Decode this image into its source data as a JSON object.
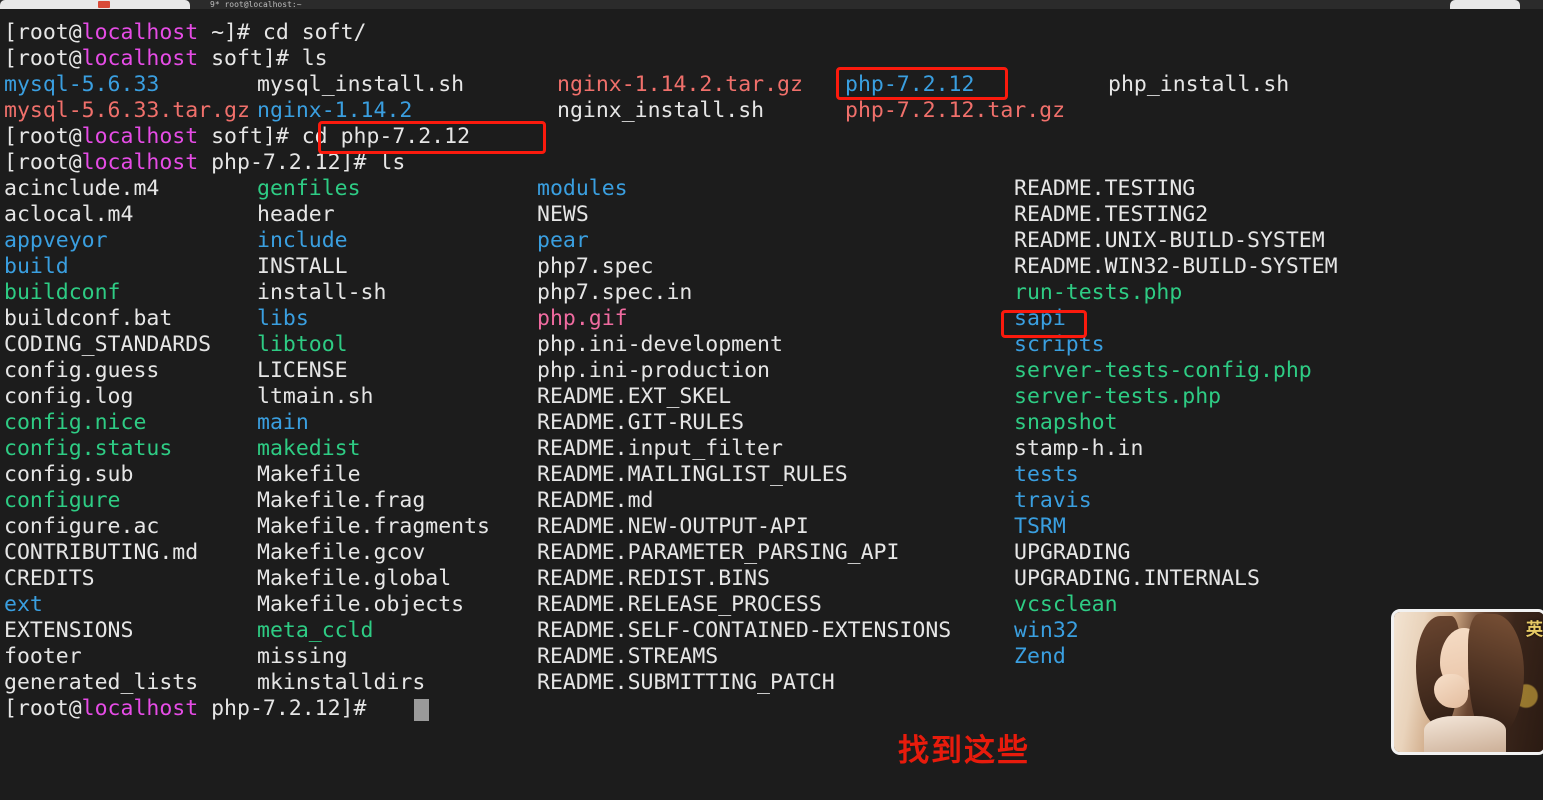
{
  "window": {
    "tab_label": "9* root@localhost:~",
    "background_color": "#1c1c1c"
  },
  "colors": {
    "white": "#e6e6e6",
    "magenta": "#e64ce6",
    "directory_blue": "#3a9fe0",
    "executable_green": "#2ecc84",
    "archive_red": "#f0706b",
    "image_pink": "#f06ba0",
    "highlight_red": "#fb1a0d",
    "annotation_red": "#e81b0c"
  },
  "terminal": {
    "prompt_segments_root": "[root@",
    "prompt_host": "localhost",
    "lines": [
      {
        "type": "prompt",
        "prefix": "[root@",
        "host": "localhost",
        "suffix": " ~]# ",
        "command": "cd soft/"
      },
      {
        "type": "prompt",
        "prefix": "[root@",
        "host": "localhost",
        "suffix": " soft]# ",
        "command": "ls"
      }
    ],
    "soft_listing": [
      [
        {
          "text": "mysql-5.6.33",
          "color": "c-dirblue"
        },
        {
          "text": "mysql_install.sh",
          "color": "c-white"
        },
        {
          "text": "nginx-1.14.2.tar.gz",
          "color": "c-red"
        },
        {
          "text": "php-7.2.12",
          "color": "c-dirblue"
        },
        {
          "text": "php_install.sh",
          "color": "c-white"
        }
      ],
      [
        {
          "text": "mysql-5.6.33.tar.gz",
          "color": "c-red"
        },
        {
          "text": "nginx-1.14.2",
          "color": "c-dirblue"
        },
        {
          "text": "nginx_install.sh",
          "color": "c-white"
        },
        {
          "text": "php-7.2.12.tar.gz",
          "color": "c-red"
        },
        {
          "text": "",
          "color": "c-white"
        }
      ]
    ],
    "cd_prompt": {
      "prefix": "[root@",
      "host": "localhost",
      "suffix": " soft]# ",
      "command": "cd php-7.2.12"
    },
    "ls_prompt": {
      "prefix": "[root@",
      "host": "localhost",
      "suffix": " php-7.2.12]# ",
      "command": "ls"
    },
    "final_prompt": {
      "prefix": "[root@",
      "host": "localhost",
      "suffix": " php-7.2.12]# ",
      "command": ""
    },
    "php_listing": {
      "column1": [
        {
          "text": "acinclude.m4",
          "color": "c-white"
        },
        {
          "text": "aclocal.m4",
          "color": "c-white"
        },
        {
          "text": "appveyor",
          "color": "c-dirblue"
        },
        {
          "text": "build",
          "color": "c-dirblue"
        },
        {
          "text": "buildconf",
          "color": "c-green"
        },
        {
          "text": "buildconf.bat",
          "color": "c-white"
        },
        {
          "text": "CODING_STANDARDS",
          "color": "c-white"
        },
        {
          "text": "config.guess",
          "color": "c-white"
        },
        {
          "text": "config.log",
          "color": "c-white"
        },
        {
          "text": "config.nice",
          "color": "c-green"
        },
        {
          "text": "config.status",
          "color": "c-green"
        },
        {
          "text": "config.sub",
          "color": "c-white"
        },
        {
          "text": "configure",
          "color": "c-green"
        },
        {
          "text": "configure.ac",
          "color": "c-white"
        },
        {
          "text": "CONTRIBUTING.md",
          "color": "c-white"
        },
        {
          "text": "CREDITS",
          "color": "c-white"
        },
        {
          "text": "ext",
          "color": "c-dirblue"
        },
        {
          "text": "EXTENSIONS",
          "color": "c-white"
        },
        {
          "text": "footer",
          "color": "c-white"
        },
        {
          "text": "generated_lists",
          "color": "c-white"
        }
      ],
      "column2": [
        {
          "text": "genfiles",
          "color": "c-green"
        },
        {
          "text": "header",
          "color": "c-white"
        },
        {
          "text": "include",
          "color": "c-dirblue"
        },
        {
          "text": "INSTALL",
          "color": "c-white"
        },
        {
          "text": "install-sh",
          "color": "c-white"
        },
        {
          "text": "libs",
          "color": "c-dirblue"
        },
        {
          "text": "libtool",
          "color": "c-green"
        },
        {
          "text": "LICENSE",
          "color": "c-white"
        },
        {
          "text": "ltmain.sh",
          "color": "c-white"
        },
        {
          "text": "main",
          "color": "c-dirblue"
        },
        {
          "text": "makedist",
          "color": "c-green"
        },
        {
          "text": "Makefile",
          "color": "c-white"
        },
        {
          "text": "Makefile.frag",
          "color": "c-white"
        },
        {
          "text": "Makefile.fragments",
          "color": "c-white"
        },
        {
          "text": "Makefile.gcov",
          "color": "c-white"
        },
        {
          "text": "Makefile.global",
          "color": "c-white"
        },
        {
          "text": "Makefile.objects",
          "color": "c-white"
        },
        {
          "text": "meta_ccld",
          "color": "c-green"
        },
        {
          "text": "missing",
          "color": "c-white"
        },
        {
          "text": "mkinstalldirs",
          "color": "c-white"
        }
      ],
      "column3": [
        {
          "text": "modules",
          "color": "c-dirblue"
        },
        {
          "text": "NEWS",
          "color": "c-white"
        },
        {
          "text": "pear",
          "color": "c-dirblue"
        },
        {
          "text": "php7.spec",
          "color": "c-white"
        },
        {
          "text": "php7.spec.in",
          "color": "c-white"
        },
        {
          "text": "php.gif",
          "color": "c-pink"
        },
        {
          "text": "php.ini-development",
          "color": "c-white"
        },
        {
          "text": "php.ini-production",
          "color": "c-white"
        },
        {
          "text": "README.EXT_SKEL",
          "color": "c-white"
        },
        {
          "text": "README.GIT-RULES",
          "color": "c-white"
        },
        {
          "text": "README.input_filter",
          "color": "c-white"
        },
        {
          "text": "README.MAILINGLIST_RULES",
          "color": "c-white"
        },
        {
          "text": "README.md",
          "color": "c-white"
        },
        {
          "text": "README.NEW-OUTPUT-API",
          "color": "c-white"
        },
        {
          "text": "README.PARAMETER_PARSING_API",
          "color": "c-white"
        },
        {
          "text": "README.REDIST.BINS",
          "color": "c-white"
        },
        {
          "text": "README.RELEASE_PROCESS",
          "color": "c-white"
        },
        {
          "text": "README.SELF-CONTAINED-EXTENSIONS",
          "color": "c-white"
        },
        {
          "text": "README.STREAMS",
          "color": "c-white"
        },
        {
          "text": "README.SUBMITTING_PATCH",
          "color": "c-white"
        }
      ],
      "column4": [
        {
          "text": "README.TESTING",
          "color": "c-white"
        },
        {
          "text": "README.TESTING2",
          "color": "c-white"
        },
        {
          "text": "README.UNIX-BUILD-SYSTEM",
          "color": "c-white"
        },
        {
          "text": "README.WIN32-BUILD-SYSTEM",
          "color": "c-white"
        },
        {
          "text": "run-tests.php",
          "color": "c-green"
        },
        {
          "text": "sapi",
          "color": "c-dirblue"
        },
        {
          "text": "scripts",
          "color": "c-dirblue"
        },
        {
          "text": "server-tests-config.php",
          "color": "c-green"
        },
        {
          "text": "server-tests.php",
          "color": "c-green"
        },
        {
          "text": "snapshot",
          "color": "c-green"
        },
        {
          "text": "stamp-h.in",
          "color": "c-white"
        },
        {
          "text": "tests",
          "color": "c-dirblue"
        },
        {
          "text": "travis",
          "color": "c-dirblue"
        },
        {
          "text": "TSRM",
          "color": "c-dirblue"
        },
        {
          "text": "UPGRADING",
          "color": "c-white"
        },
        {
          "text": "UPGRADING.INTERNALS",
          "color": "c-white"
        },
        {
          "text": "vcsclean",
          "color": "c-green"
        },
        {
          "text": "win32",
          "color": "c-dirblue"
        },
        {
          "text": "Zend",
          "color": "c-dirblue"
        }
      ]
    }
  },
  "annotations": {
    "note_text": "找到这些",
    "highlight_boxes": [
      {
        "name": "php-dir-highlight",
        "target": "php-7.2.12"
      },
      {
        "name": "cd-command-highlight",
        "target": "cd php-7.2.12"
      },
      {
        "name": "sapi-highlight",
        "target": "sapi"
      }
    ]
  },
  "watermark": {
    "caption": "英"
  }
}
